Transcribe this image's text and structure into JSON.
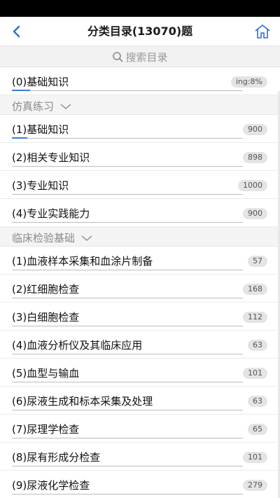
{
  "header": {
    "title": "分类目录(13070)题"
  },
  "search": {
    "placeholder": "搜索目录"
  },
  "top_item": {
    "label": "(0)基础知识",
    "badge": "ing:8%",
    "progress": 0.08
  },
  "sections": [
    {
      "title": "仿真练习",
      "items": [
        {
          "label": "(1)基础知识",
          "count": "900"
        },
        {
          "label": "(2)相关专业知识",
          "count": "898"
        },
        {
          "label": "(3)专业知识",
          "count": "1000"
        },
        {
          "label": "(4)专业实践能力",
          "count": "900"
        }
      ]
    },
    {
      "title": "临床检验基础",
      "items": [
        {
          "label": "(1)血液样本采集和血涂片制备",
          "count": "57"
        },
        {
          "label": "(2)红细胞检查",
          "count": "168"
        },
        {
          "label": "(3)白细胞检查",
          "count": "112"
        },
        {
          "label": "(4)血液分析仪及其临床应用",
          "count": "63"
        },
        {
          "label": "(5)血型与输血",
          "count": "101"
        },
        {
          "label": "(6)尿液生成和标本采集及处理",
          "count": "63"
        },
        {
          "label": "(7)尿理学检查",
          "count": "65"
        },
        {
          "label": "(8)尿有形成分检查",
          "count": "101"
        },
        {
          "label": "(9)尿液化学检查",
          "count": "279"
        }
      ]
    }
  ],
  "icons": {
    "back": "chevron-left-icon",
    "home": "home-icon",
    "search": "search-icon",
    "expand": "chevron-down-icon"
  },
  "colors": {
    "accent": "#3b7bd8",
    "badge_bg": "#e4e4e4"
  }
}
